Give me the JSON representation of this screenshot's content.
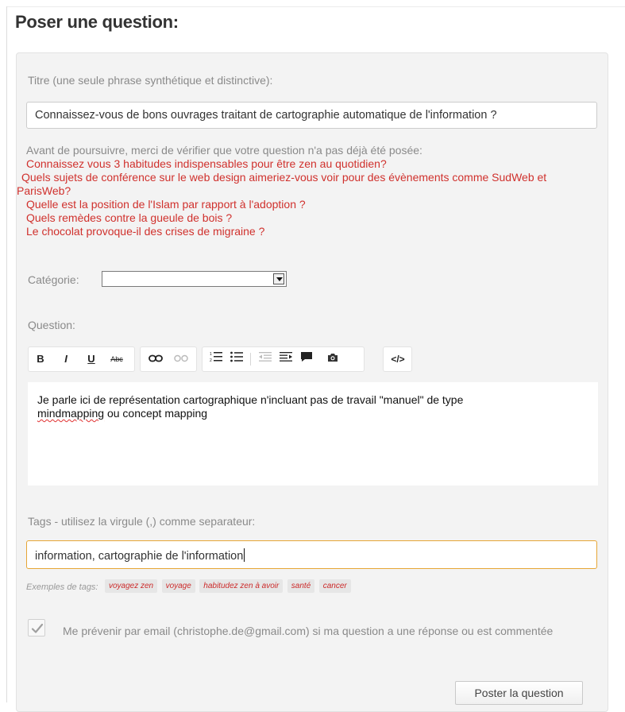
{
  "page": {
    "title": "Poser une question:"
  },
  "form": {
    "title_label": "Titre (une seule phrase synthétique et distinctive):",
    "title_value": "Connaissez-vous de bons ouvrages traitant de cartographie automatique de l'information ?",
    "duplicates": {
      "intro": "Avant de poursuivre, merci de vérifier que votre question n'a pas déjà été posée:",
      "links": [
        "Connaissez vous 3 habitudes indispensables pour être zen au quotidien?",
        "Quels sujets de conférence sur le web design aimeriez-vous voir pour des évènements comme SudWeb et ParisWeb?",
        "Quelle est la position de l'Islam par rapport à l'adoption ?",
        "Quels remèdes contre la gueule de bois ?",
        "Le chocolat provoque-il des crises de migraine ?"
      ]
    },
    "category_label": "Catégorie:",
    "category_value": "",
    "question_label": "Question:",
    "toolbar": {
      "bold": "B",
      "italic": "I",
      "underline": "U",
      "strike": "Abc",
      "link_icon": "link-icon",
      "unlink_icon": "unlink-icon",
      "ordered_list_icon": "ordered-list-icon",
      "bullet_list_icon": "bullet-list-icon",
      "outdent_icon": "outdent-icon",
      "indent_icon": "indent-icon",
      "quote_icon": "quote-icon",
      "image_icon": "camera-icon",
      "code": "</>"
    },
    "question_text_line1": "Je parle ici de représentation cartographique n'incluant pas de travail \"manuel\" de type",
    "question_text_misspelled": "mindmapping",
    "question_text_line2_rest": " ou concept mapping",
    "tags_label": "Tags - utilisez la virgule (,) comme separateur:",
    "tags_value": "information, cartographie de l'information",
    "tag_examples_label": "Exemples de tags:",
    "tag_examples": [
      "voyagez zen",
      "voyage",
      "habitudez zen à avoir",
      "santé",
      "cancer"
    ],
    "notify_checked": true,
    "notify_text": "Me prévenir par email (christophe.de@gmail.com) si ma question a une réponse ou est commentée",
    "submit_label": "Poster la question"
  },
  "colors": {
    "link": "#d0312d",
    "label": "#8a8a8a",
    "focus_border": "#e6a636"
  }
}
